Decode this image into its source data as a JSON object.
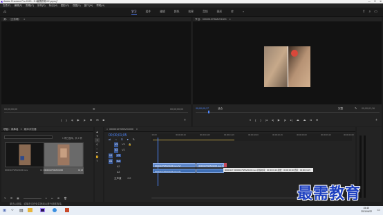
{
  "titlebar": {
    "title": "Adobe Premiere Pro 2020 - E:\\最需教育\\22.prproj *",
    "minimize": "—",
    "maximize": "☐",
    "close": "✕"
  },
  "menubar": {
    "items": [
      "文件(F)",
      "编辑(E)",
      "剪辑(C)",
      "序列(S)",
      "标记(M)",
      "图形(G)",
      "视图(V)",
      "窗口(W)",
      "帮助(H)"
    ]
  },
  "workspace": {
    "tabs": [
      "学习",
      "组件",
      "编辑",
      "颜色",
      "效果",
      "音频",
      "图形",
      "库"
    ],
    "active_index": 0,
    "more": "»"
  },
  "source_monitor": {
    "tab": "源：（无剪辑）",
    "tc_left": "00;00;00;00",
    "tc_right": "00;00;00;00",
    "clip_prompt": "（无剪辑）"
  },
  "program_monitor": {
    "tab": "节目：00000107WMV01000",
    "tc_current": "00;00;00;17",
    "fit": "适合",
    "quality": "完整",
    "tc_duration": "00;00;01;16"
  },
  "project_panel": {
    "tabs": [
      "项目：未命名",
      "媒体浏览器"
    ],
    "search_hint": "1 项已选择，共 2 项",
    "items": [
      {
        "name": "00000107WMV01000.mov",
        "duration": "01;16"
      },
      {
        "name": "00000107WMV01000",
        "duration": "01;16"
      }
    ]
  },
  "timeline": {
    "tab": "00000107WMV01000",
    "timecode": "00;00;01;05",
    "ruler": [
      ":00;00",
      "00;00;00;16",
      "00;00;01;00",
      "00;00;01;16",
      "00;00;02;00",
      "00;00;02;16",
      "00;00;03;00",
      "00;00;03;16",
      "00;00;04;00"
    ],
    "tracks": [
      "V3",
      "V2",
      "V1",
      "A1",
      "A2",
      "A3"
    ],
    "master": "主声道",
    "master_value": "0.0",
    "v_clip_a": "00000107WMV01000.mov [V]",
    "v_clip_b": "00000107WMV01000.mov [V]",
    "a_clip_a": "00000107WMV01000.mov [A]",
    "tooltip": "00000107 00000107WMV01000.mov 持续时间：00;00;01;16 起始：00;00;00;00 结束：00;00;01;15"
  },
  "status": {
    "text": "单击以选择，或单击空白处并拖动以进行选框选择。"
  },
  "taskbar": {
    "time": "15:40",
    "date": "2021/06/22"
  },
  "watermark": {
    "text": "最需教育"
  },
  "colors": {
    "accent": "#4d86ff",
    "video_clip": "#5d86c9",
    "audio_clip": "#3f6fb5"
  }
}
